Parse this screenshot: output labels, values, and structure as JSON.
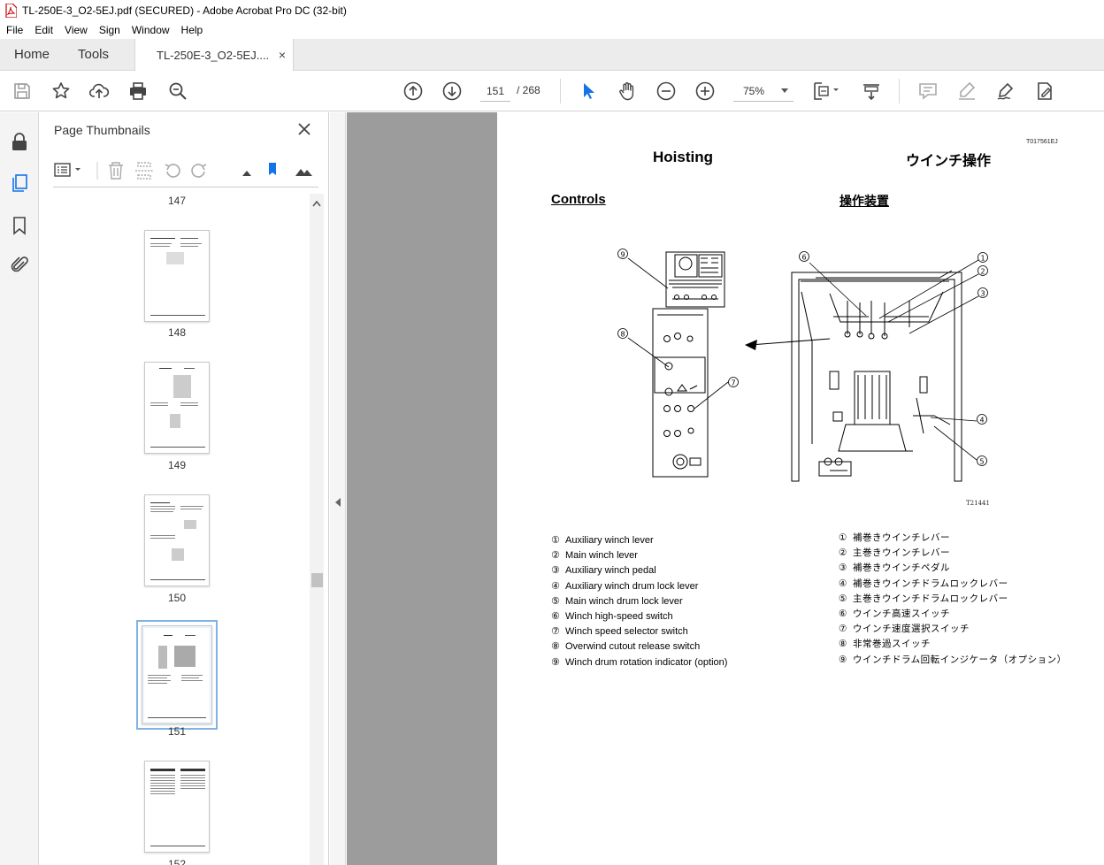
{
  "window": {
    "title": "TL-250E-3_O2-5EJ.pdf (SECURED) - Adobe Acrobat Pro DC (32-bit)"
  },
  "menu": [
    "File",
    "Edit",
    "View",
    "Sign",
    "Window",
    "Help"
  ],
  "tabs": {
    "home": "Home",
    "tools": "Tools",
    "doc": "TL-250E-3_O2-5EJ....",
    "doc_close": "×"
  },
  "toolbar": {
    "page_current": "151",
    "page_total": "/  268",
    "zoom": "75%",
    "icons": [
      "save-icon",
      "bookmark-star-icon",
      "upload-icon",
      "print-icon",
      "search-zoom-icon",
      "prev-page-icon",
      "next-page-icon",
      "select-cursor-icon",
      "hand-tool-icon",
      "zoom-out-icon",
      "zoom-in-icon",
      "fit-page-icon",
      "scroll-mode-icon",
      "comment-icon",
      "highlight-icon",
      "sign-icon",
      "fill-sign-icon"
    ]
  },
  "thumbnails": {
    "title": "Page Thumbnails",
    "pages": [
      "147",
      "148",
      "149",
      "150",
      "151",
      "152"
    ],
    "selected": "151"
  },
  "page": {
    "code": "T017561EJ",
    "title_en": "Hoisting",
    "title_ja": "ウインチ操作",
    "section_en": "Controls",
    "section_ja": "操作装置",
    "figure_code": "T21441",
    "callouts": [
      "①",
      "②",
      "③",
      "④",
      "⑤",
      "⑥",
      "⑦",
      "⑧",
      "⑨"
    ],
    "legend_en": [
      {
        "n": "①",
        "t": "Auxiliary winch lever"
      },
      {
        "n": "②",
        "t": "Main winch lever"
      },
      {
        "n": "③",
        "t": "Auxiliary winch pedal"
      },
      {
        "n": "④",
        "t": "Auxiliary winch drum lock lever"
      },
      {
        "n": "⑤",
        "t": "Main winch drum lock lever"
      },
      {
        "n": "⑥",
        "t": "Winch high-speed switch"
      },
      {
        "n": "⑦",
        "t": "Winch speed selector switch"
      },
      {
        "n": "⑧",
        "t": "Overwind cutout release switch"
      },
      {
        "n": "⑨",
        "t": "Winch drum rotation indicator (option)"
      }
    ],
    "legend_ja": [
      {
        "n": "①",
        "t": "補巻きウインチレバー"
      },
      {
        "n": "②",
        "t": "主巻きウインチレバー"
      },
      {
        "n": "③",
        "t": "補巻きウインチペダル"
      },
      {
        "n": "④",
        "t": "補巻きウインチドラムロックレバー"
      },
      {
        "n": "⑤",
        "t": "主巻きウインチドラムロックレバー"
      },
      {
        "n": "⑥",
        "t": "ウインチ高速スイッチ"
      },
      {
        "n": "⑦",
        "t": "ウインチ速度選択スイッチ"
      },
      {
        "n": "⑧",
        "t": "非常巻過スイッチ"
      },
      {
        "n": "⑨",
        "t": "ウインチドラム回転インジケータ（オプション）"
      }
    ]
  }
}
